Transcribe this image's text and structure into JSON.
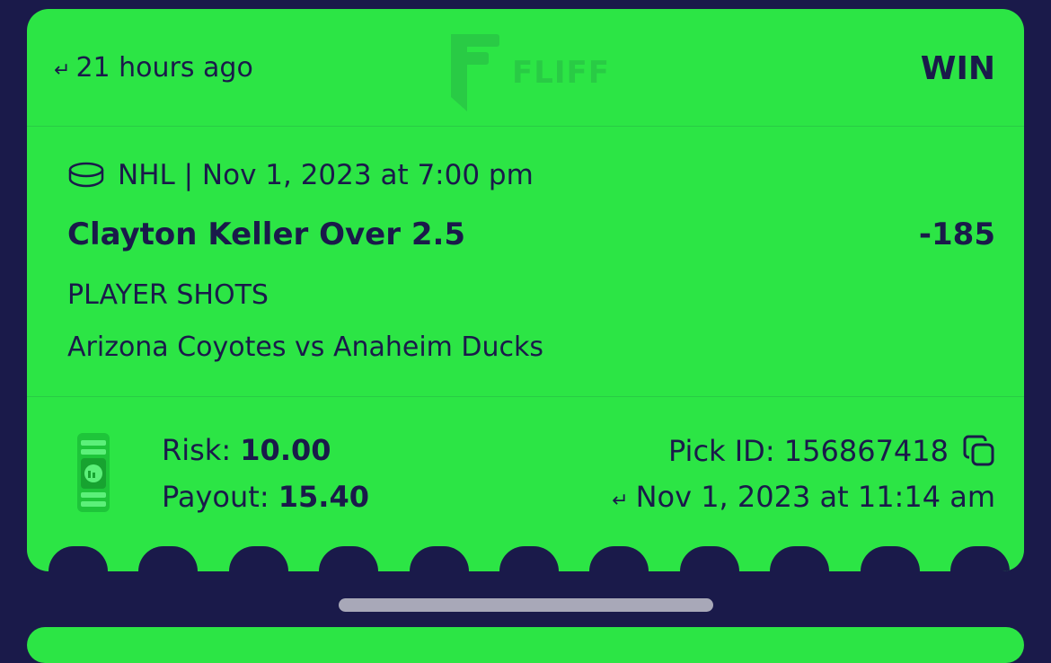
{
  "header": {
    "time_ago": "21 hours ago",
    "logo_text": "FLIFF",
    "result": "WIN"
  },
  "bet": {
    "league_date": "NHL | Nov 1, 2023 at 7:00 pm",
    "sport_icon": "hockey-puck-icon",
    "selection": "Clayton Keller Over 2.5",
    "odds": "-185",
    "market": "PLAYER SHOTS",
    "matchup": "Arizona Coyotes vs Anaheim Ducks"
  },
  "footer": {
    "risk_label": "Risk:",
    "risk_value": "10.00",
    "payout_label": "Payout:",
    "payout_value": "15.40",
    "pick_id_label": "Pick ID:",
    "pick_id_value": "156867418",
    "placed_at": "Nov 1, 2023 at 11:14 am"
  },
  "colors": {
    "card_green": "#2ce545",
    "navy": "#1a1a4a",
    "home_indicator": "#a8a8b8"
  }
}
